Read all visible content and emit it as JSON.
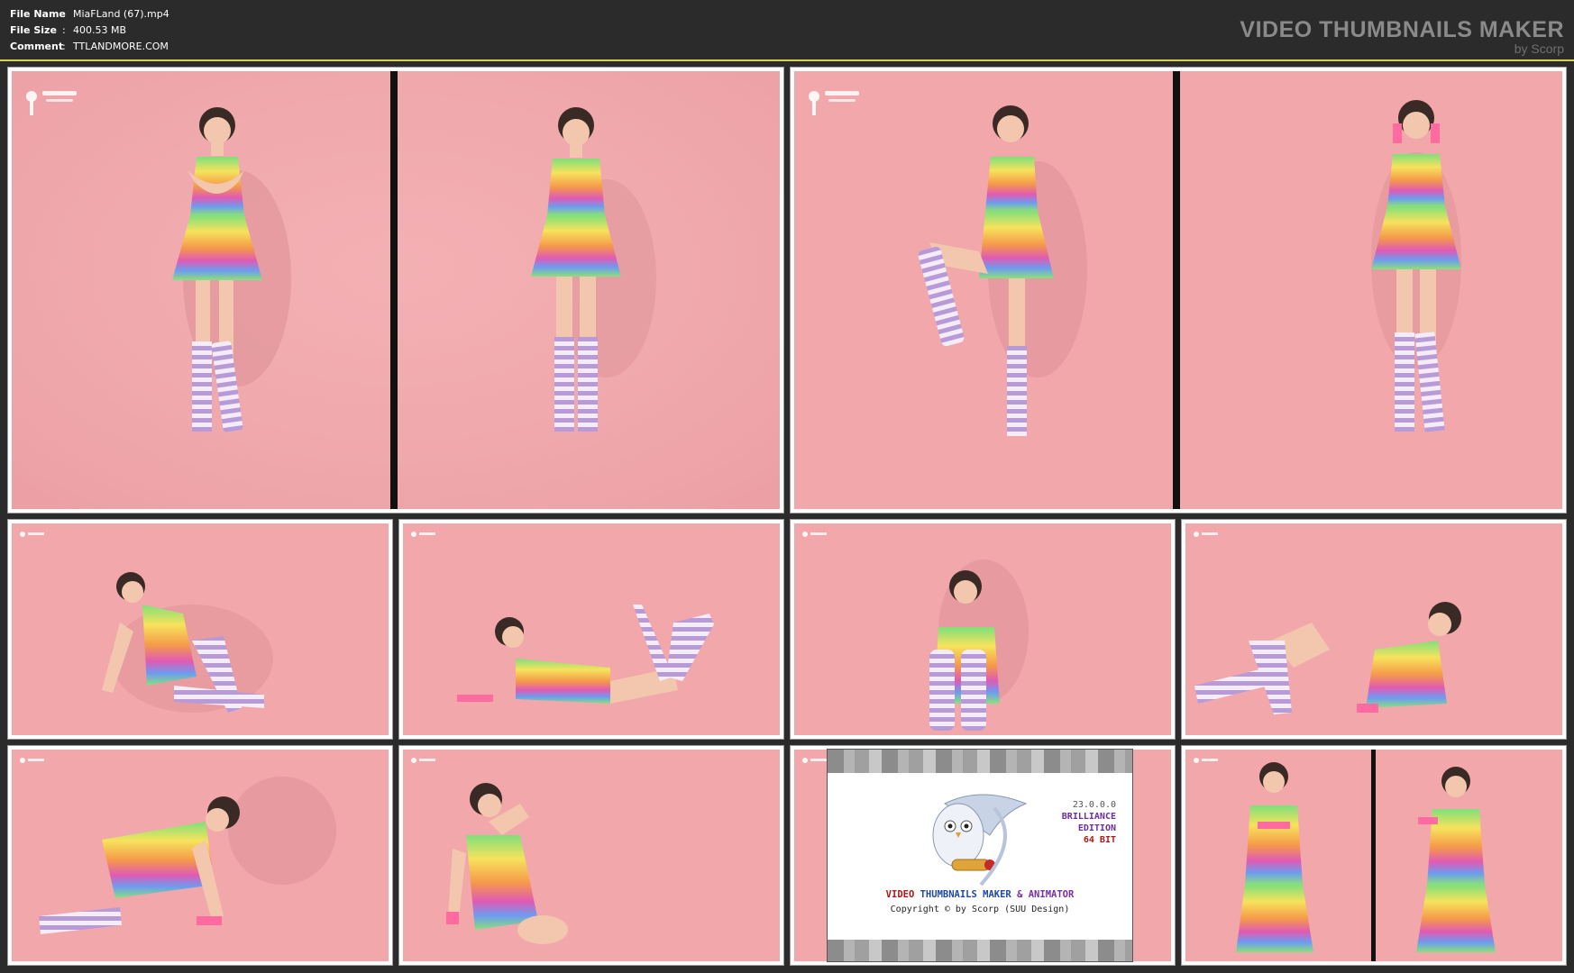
{
  "header": {
    "rows": [
      {
        "key": "File Name",
        "sep": ":",
        "value": "MiaFLand (67).mp4"
      },
      {
        "key": "File Size",
        "sep": ":",
        "value": "400.53 MB"
      },
      {
        "key": "Comment",
        "sep": ":",
        "value": "TTLANDMORE.COM"
      }
    ],
    "brand_title": "VIDEO THUMBNAILS MAKER",
    "brand_sub": "by Scorp"
  },
  "splash": {
    "version": "23.0.0.0",
    "edition_line1": "BRILLIANCE",
    "edition_line2": "EDITION",
    "bitness": "64 BIT",
    "title_part1": "VIDEO",
    "title_part2": "THUMBNAILS MAKER",
    "title_part3": "& ANIMATOR",
    "copyright": "Copyright © by Scorp (SUU Design)"
  },
  "colors": {
    "background": "#2b2b2b",
    "accent_divider": "#d8d050",
    "frame_bg": "#f2a7ab",
    "shadow": "#d98b90"
  },
  "thumbnails": [
    {
      "pose": "standing-arms-crossed"
    },
    {
      "pose": "standing-front"
    },
    {
      "pose": "standing-leg-raised"
    },
    {
      "pose": "standing-hands-to-face"
    },
    {
      "pose": "sitting-leaning"
    },
    {
      "pose": "lying-legs-up"
    },
    {
      "pose": "sitting-knees-up"
    },
    {
      "pose": "reclining-on-side"
    },
    {
      "pose": "kneeling-on-all-fours"
    },
    {
      "pose": "sitting-kneeling-arm-up"
    },
    {
      "pose": "splash-screen"
    },
    {
      "pose": "standing-two-views"
    }
  ]
}
